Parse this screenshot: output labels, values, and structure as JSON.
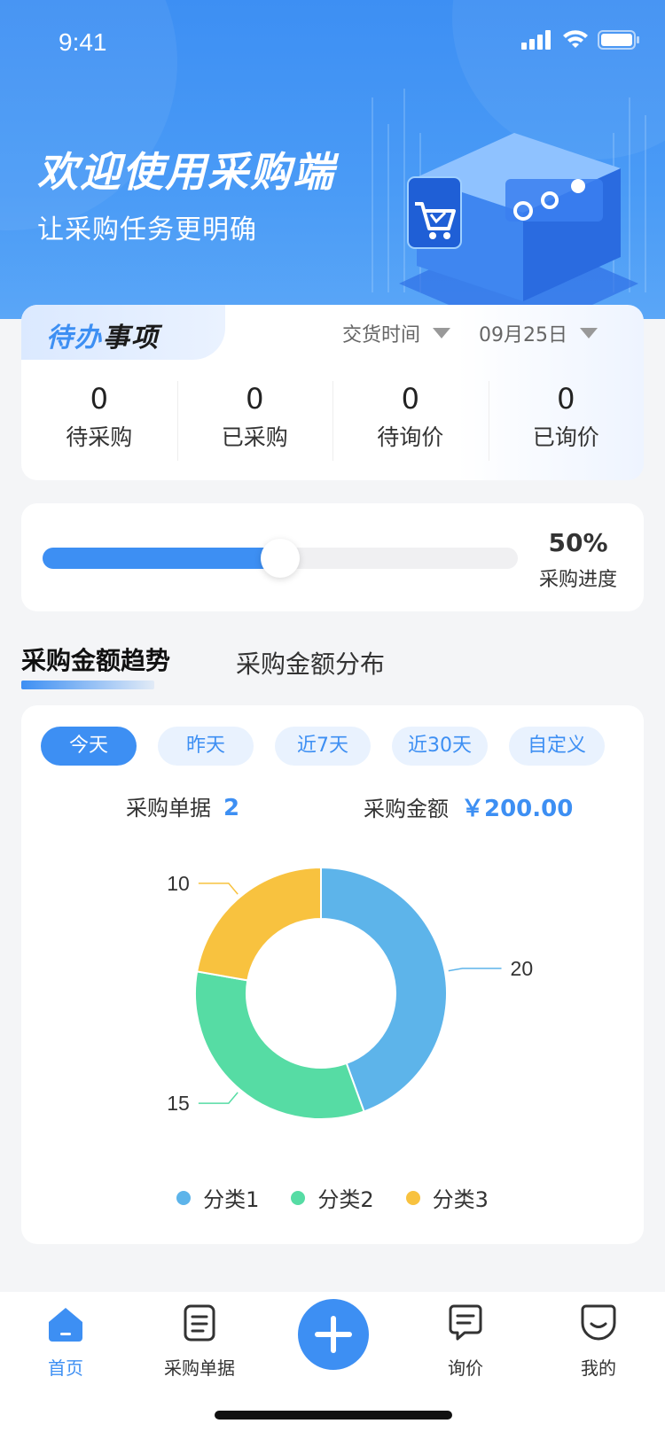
{
  "status_bar": {
    "time": "9:41"
  },
  "hero": {
    "title": "欢迎使用采购端",
    "subtitle": "让采购任务更明确"
  },
  "todo": {
    "tag_part1": "待办",
    "tag_part2": "事项",
    "filter_delivery": "交货时间",
    "filter_date": "09月25日",
    "stats": [
      {
        "value": "0",
        "label": "待采购"
      },
      {
        "value": "0",
        "label": "已采购"
      },
      {
        "value": "0",
        "label": "待询价"
      },
      {
        "value": "0",
        "label": "已询价"
      }
    ]
  },
  "progress": {
    "percent_text": "50%",
    "value": 0.5,
    "label": "采购进度"
  },
  "section_tabs": {
    "active": "采购金额趋势",
    "inactive": "采购金额分布"
  },
  "filters": {
    "pills": [
      "今天",
      "昨天",
      "近7天",
      "近30天",
      "自定义"
    ],
    "active_index": 0
  },
  "summary": {
    "orders_label": "采购单据",
    "orders_value": "2",
    "amount_label": "采购金额",
    "amount_value": "￥200.00"
  },
  "chart_data": {
    "type": "pie",
    "donut": true,
    "categories": [
      "分类1",
      "分类2",
      "分类3"
    ],
    "values": [
      20,
      15,
      10
    ],
    "data_labels": [
      "20",
      "15",
      "10"
    ],
    "colors": [
      "#5db4ea",
      "#56dca4",
      "#f8c23f"
    ],
    "legend_position": "bottom"
  },
  "tabbar": {
    "items": [
      {
        "label": "首页",
        "icon": "home-icon",
        "active": true
      },
      {
        "label": "采购单据",
        "icon": "document-icon",
        "active": false
      },
      {
        "label": "",
        "icon": "plus-icon",
        "active": false
      },
      {
        "label": "询价",
        "icon": "chat-icon",
        "active": false
      },
      {
        "label": "我的",
        "icon": "smile-icon",
        "active": false
      }
    ]
  },
  "colors": {
    "primary": "#3d8ff3",
    "background": "#f4f5f7"
  }
}
